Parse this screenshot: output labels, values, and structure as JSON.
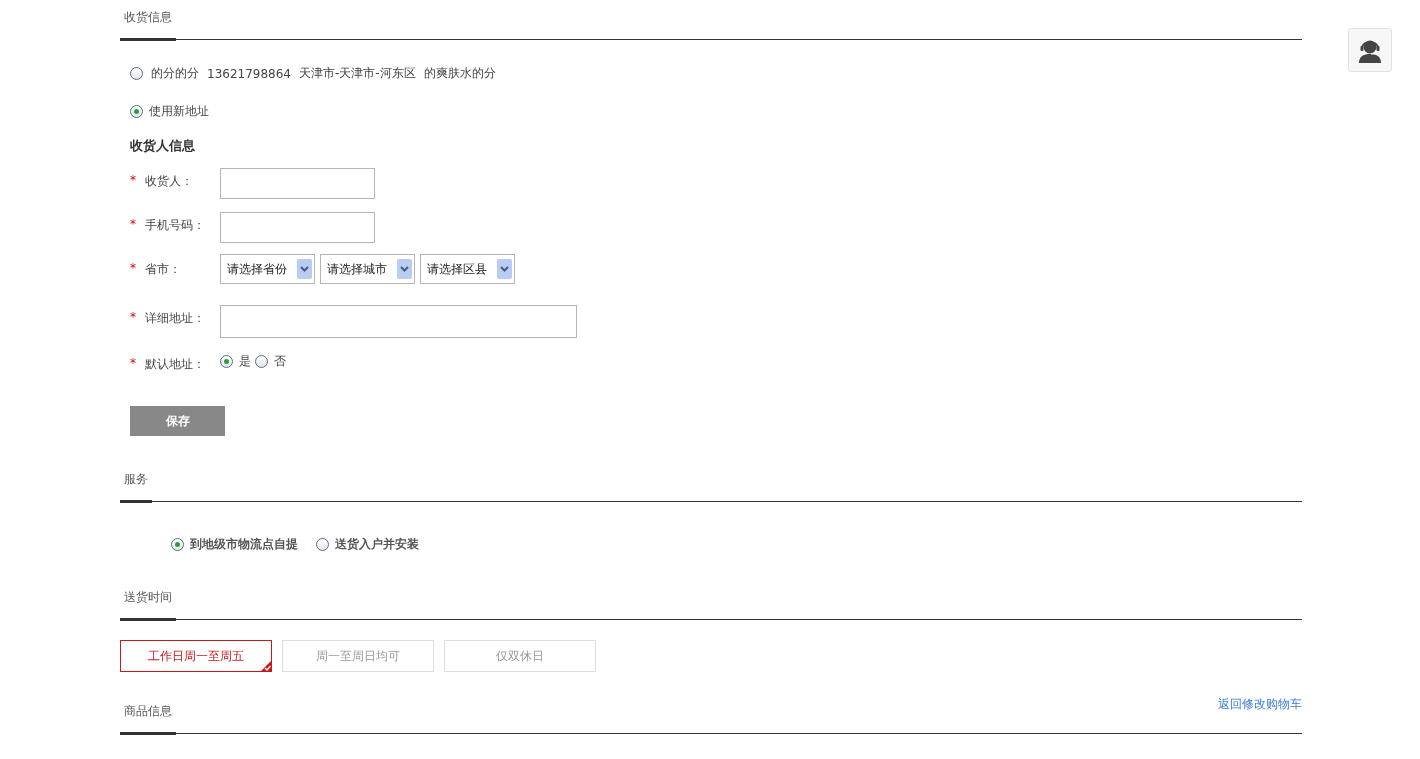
{
  "address": {
    "title": "收货信息",
    "saved": [
      {
        "parts": [
          "的分的分",
          "13621798864",
          "天津市-天津市-河东区",
          "的爽肤水的分"
        ],
        "selected": false
      }
    ],
    "new_address": {
      "label": "使用新地址",
      "selected": true
    },
    "form_title": "收货人信息",
    "fields": [
      {
        "kind": "text",
        "mark": "*",
        "label": "收货人：",
        "wide": false
      },
      {
        "kind": "text",
        "mark": "*",
        "label": "手机号码：",
        "wide": false
      },
      {
        "kind": "select",
        "mark": "*",
        "label": "省市：",
        "options": [
          "请选择省份",
          "请选择城市",
          "请选择区县"
        ]
      },
      {
        "kind": "text",
        "mark": "*",
        "label": "详细地址：",
        "wide": true
      },
      {
        "kind": "radio",
        "mark": "*",
        "label": "默认地址：",
        "options": [
          {
            "label": "是",
            "selected": true
          },
          {
            "label": "否",
            "selected": false
          }
        ]
      }
    ],
    "save_button": "保存"
  },
  "service": {
    "title": "服务",
    "options": [
      {
        "label": "到地级市物流点自提",
        "selected": true
      },
      {
        "label": "送货入户并安装",
        "selected": false
      }
    ]
  },
  "delivery_time": {
    "title": "送货时间",
    "options": [
      {
        "label": "工作日周一至周五",
        "selected": true
      },
      {
        "label": "周一至周日均可",
        "selected": false
      },
      {
        "label": "仅双休日",
        "selected": false
      }
    ]
  },
  "goods": {
    "title": "商品信息",
    "link": "返回修改购物车"
  }
}
